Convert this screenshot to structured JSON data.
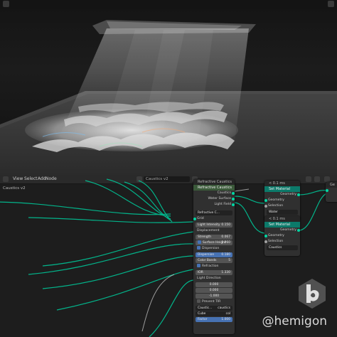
{
  "viewport": {
    "top_right_label": "⋯"
  },
  "node_editor": {
    "menu": [
      "View",
      "Select",
      "Add",
      "Node"
    ],
    "node_group_name": "Caustics v2",
    "breadcrumb": "Caustics v2"
  },
  "nodes": {
    "group_node": {
      "title": "Refractive Caustics",
      "pre_title": "Refractive Caustics",
      "outputs": [
        "Caustics",
        "Water Surface",
        "Light Field"
      ],
      "group_selector": "Refractive C...",
      "fields": {
        "grid": "Grid",
        "light_intensity_label": "Light Intensity",
        "light_intensity": "0.150",
        "displacement_label": "Displacement",
        "strength_label": "Strength",
        "strength": "0.067",
        "surface_height_label": "Surface Height",
        "surface_height": "1.260",
        "dispersion_label": "Dispersion",
        "dispersion_value_label": "Dispersion",
        "dispersion_value": "0.180",
        "color_bands_label": "Color Bands",
        "color_bands": "5",
        "refraction_label": "Refraction",
        "ior_label": "IOR",
        "ior": "1.330",
        "light_direction_label": "Light Direction",
        "light_x": "0.000",
        "light_y": "0.000",
        "light_z": "-1.000",
        "prevent_tir_label": "Prevent TIR",
        "caustics_label": "Caustic...",
        "caustics_value": "caustics",
        "cube_label": "Cube",
        "cube_value": "col",
        "factor_label": "Factor",
        "factor": "1.000"
      }
    },
    "set_material_1": {
      "timing": "< 0.1 ms",
      "title": "Set Material",
      "output": "Geometry",
      "inputs": [
        "Geometry",
        "Selection"
      ],
      "material": "Water"
    },
    "set_material_2": {
      "timing": "< 0.1 ms",
      "title": "Set Material",
      "output": "Geometry",
      "inputs": [
        "Geometry",
        "Selection"
      ],
      "material": "Caustics"
    },
    "output_node": {
      "title": "Ge"
    }
  },
  "watermark": {
    "text": "@hemigon"
  },
  "colors": {
    "geometry_socket": "#00d6a3",
    "node_header_geometry": "#0c7a6a",
    "selection_blue": "#4772b3"
  }
}
